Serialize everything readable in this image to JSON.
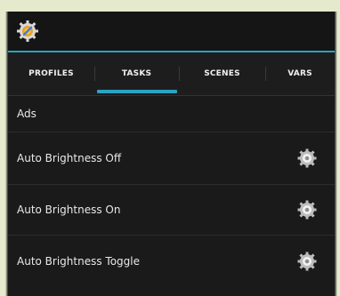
{
  "app": {
    "icon": "tasker-app-icon"
  },
  "tabs": [
    {
      "label": "PROFILES"
    },
    {
      "label": "TASKS"
    },
    {
      "label": "SCENES"
    },
    {
      "label": "VARS"
    }
  ],
  "active_tab": "TASKS",
  "tasks": [
    {
      "label": "Ads",
      "icon": null
    },
    {
      "label": "Auto Brightness Off",
      "icon": "gear-icon"
    },
    {
      "label": "Auto Brightness On",
      "icon": "gear-icon"
    },
    {
      "label": "Auto Brightness Toggle",
      "icon": "gear-icon"
    }
  ],
  "colors": {
    "accent": "#2aa3c4",
    "background": "#1a1a1a",
    "outer_background": "#e6eacd"
  }
}
